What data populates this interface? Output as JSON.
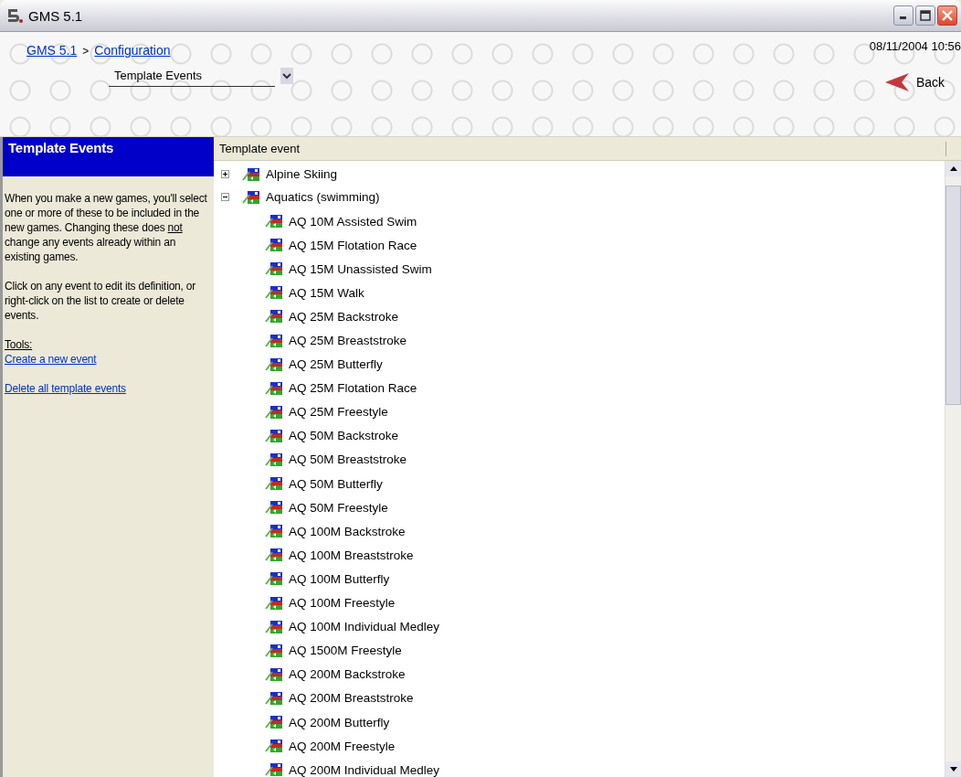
{
  "window": {
    "title": "GMS 5.1"
  },
  "header": {
    "breadcrumb": [
      {
        "label": "GMS 5.1"
      },
      {
        "label": "Configuration"
      }
    ],
    "separator": ">",
    "dropdown": {
      "value": "Template Events"
    },
    "datetime": "08/11/2004 10:56",
    "back_button": "Back"
  },
  "sidebar": {
    "title": "Template Events",
    "paragraphs": [
      [
        {
          "text": "When you make a new games, you'll select one or more of these to be included in the new games. Changing these does ",
          "underline": false
        },
        {
          "text": "not",
          "underline": true
        },
        {
          "text": " change any events already within an existing games.",
          "underline": false
        }
      ],
      [
        {
          "text": "Click on any event to edit its definition, or right-click on the list to create or delete events.",
          "underline": false
        }
      ]
    ],
    "tools_label": "Tools:",
    "links": [
      "Create a new event",
      "Delete all template events"
    ]
  },
  "tree": {
    "column": "Template event",
    "nodes": [
      {
        "label": "Alpine Skiing",
        "expanded": false
      },
      {
        "label": "Aquatics (swimming)",
        "expanded": true,
        "children": [
          {
            "label": "AQ  10M Assisted Swim"
          },
          {
            "label": "AQ  15M Flotation Race"
          },
          {
            "label": "AQ  15M Unassisted Swim"
          },
          {
            "label": "AQ  15M Walk"
          },
          {
            "label": "AQ  25M Backstroke"
          },
          {
            "label": "AQ  25M Breaststroke"
          },
          {
            "label": "AQ  25M Butterfly"
          },
          {
            "label": "AQ  25M Flotation Race"
          },
          {
            "label": "AQ  25M Freestyle"
          },
          {
            "label": "AQ  50M Backstroke"
          },
          {
            "label": "AQ  50M Breaststroke"
          },
          {
            "label": "AQ  50M Butterfly"
          },
          {
            "label": "AQ  50M Freestyle"
          },
          {
            "label": "AQ  100M Backstroke"
          },
          {
            "label": "AQ  100M Breaststroke"
          },
          {
            "label": "AQ  100M Butterfly"
          },
          {
            "label": "AQ  100M Freestyle"
          },
          {
            "label": "AQ  100M Individual Medley"
          },
          {
            "label": "AQ  1500M Freestyle"
          },
          {
            "label": "AQ  200M Backstroke"
          },
          {
            "label": "AQ  200M Breaststroke"
          },
          {
            "label": "AQ  200M Butterfly"
          },
          {
            "label": "AQ  200M Freestyle"
          },
          {
            "label": "AQ  200M Individual Medley"
          }
        ]
      }
    ]
  }
}
